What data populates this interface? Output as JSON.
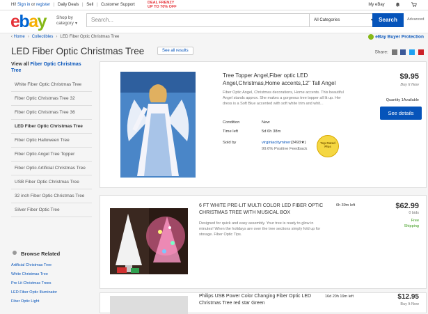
{
  "topbar": {
    "greeting": "Hi!",
    "signin": "Sign in",
    "or": "or",
    "register": "register",
    "daily_deals": "Daily Deals",
    "sell": "Sell",
    "customer_support": "Customer Support",
    "promo_line1": "DEAL FRENZY",
    "promo_line2": "UP TO 70% OFF",
    "my_ebay": "My eBay"
  },
  "header": {
    "logo_e": "e",
    "logo_b": "b",
    "logo_a": "a",
    "logo_y": "y",
    "shop_by": "Shop by",
    "category": "category",
    "search_placeholder": "Search...",
    "category_select": "All Categories",
    "search_button": "Search",
    "advanced": "Advanced"
  },
  "breadcrumb": {
    "home": "Home",
    "collectibles": "Collectibles",
    "current": "LED Fiber Optic Christmas Tree"
  },
  "buyer_protection": "eBay Buyer Protection",
  "page_title": "LED Fiber Optic Christmas Tree",
  "see_all": "See all results",
  "share_label": "Share:",
  "sidebar": {
    "view_all_prefix": "View all",
    "view_all_link": "Fiber Optic Christmas Tree",
    "items": [
      {
        "label": "White Fiber Optic Christmas Tree"
      },
      {
        "label": "Fiber Optic Christmas Tree 32"
      },
      {
        "label": "Fiber Optic Christmas Tree 36"
      },
      {
        "label": "LED Fiber Optic Christmas Tree"
      },
      {
        "label": "Fiber Optic Halloween Tree"
      },
      {
        "label": "Fiber Optic Angel Tree Topper"
      },
      {
        "label": "Fiber Optic Artificial Christmas Tree"
      },
      {
        "label": "USB Fiber Optic Christmas Tree"
      },
      {
        "label": "32 inch Fiber Optic Christmas Tree"
      },
      {
        "label": "Silver Fiber Optic Tree"
      }
    ]
  },
  "browse_related": {
    "title": "Browse Related",
    "links": [
      "Artificial Christmas Tree",
      "White Christmas Tree",
      "Pre Lit Christmas Trees",
      "LED Fiber Optic Illuminator",
      "Fiber Optic Light"
    ]
  },
  "listings": [
    {
      "title": "Tree Topper Angel,Fiber optic LED Angel,Christmas,Home accents,12\" Tall Angel",
      "description": "Fiber Optic Angel, Christmas decorations, Home accents. This beautiful Angel stands approx. She makes a gorgeous tree topper all lit up. Her dress is a Soft Blue accented with soft white trim and whit...",
      "condition_label": "Condition",
      "condition": "New",
      "time_left_label": "Time left",
      "time_left": "5d 6h 38m",
      "sold_by_label": "Sold by",
      "seller": "virginiacityminer",
      "seller_score": "(3493★)",
      "feedback": "99.6% Positive Feedback",
      "badge": "Top Rated Plus",
      "price": "$9.95",
      "format": "Buy It Now",
      "quantity": "Quantity 1Available",
      "cta": "See details"
    },
    {
      "title": "6 FT WHITE PRE-LIT MULTI COLOR LED FIBER OPTIC CHRISTMAS TREE WITH MUSICAL BOX",
      "description": "Designed for quick and easy assembly. Your tree is ready to glow in minutes! When the holidays are over the tree sections simply fold up for storage. Fiber Optic Tips.",
      "time_left": "6h 39m left",
      "price": "$62.99",
      "bids": "0 bids",
      "shipping_1": "Free",
      "shipping_2": "Shipping"
    },
    {
      "title": "Philips USB Power Color Changing Fiber Optic LED Christmas Tree red star Green",
      "time_left": "16d 20h 19m left",
      "price": "$12.95",
      "format": "Buy It Now"
    }
  ]
}
